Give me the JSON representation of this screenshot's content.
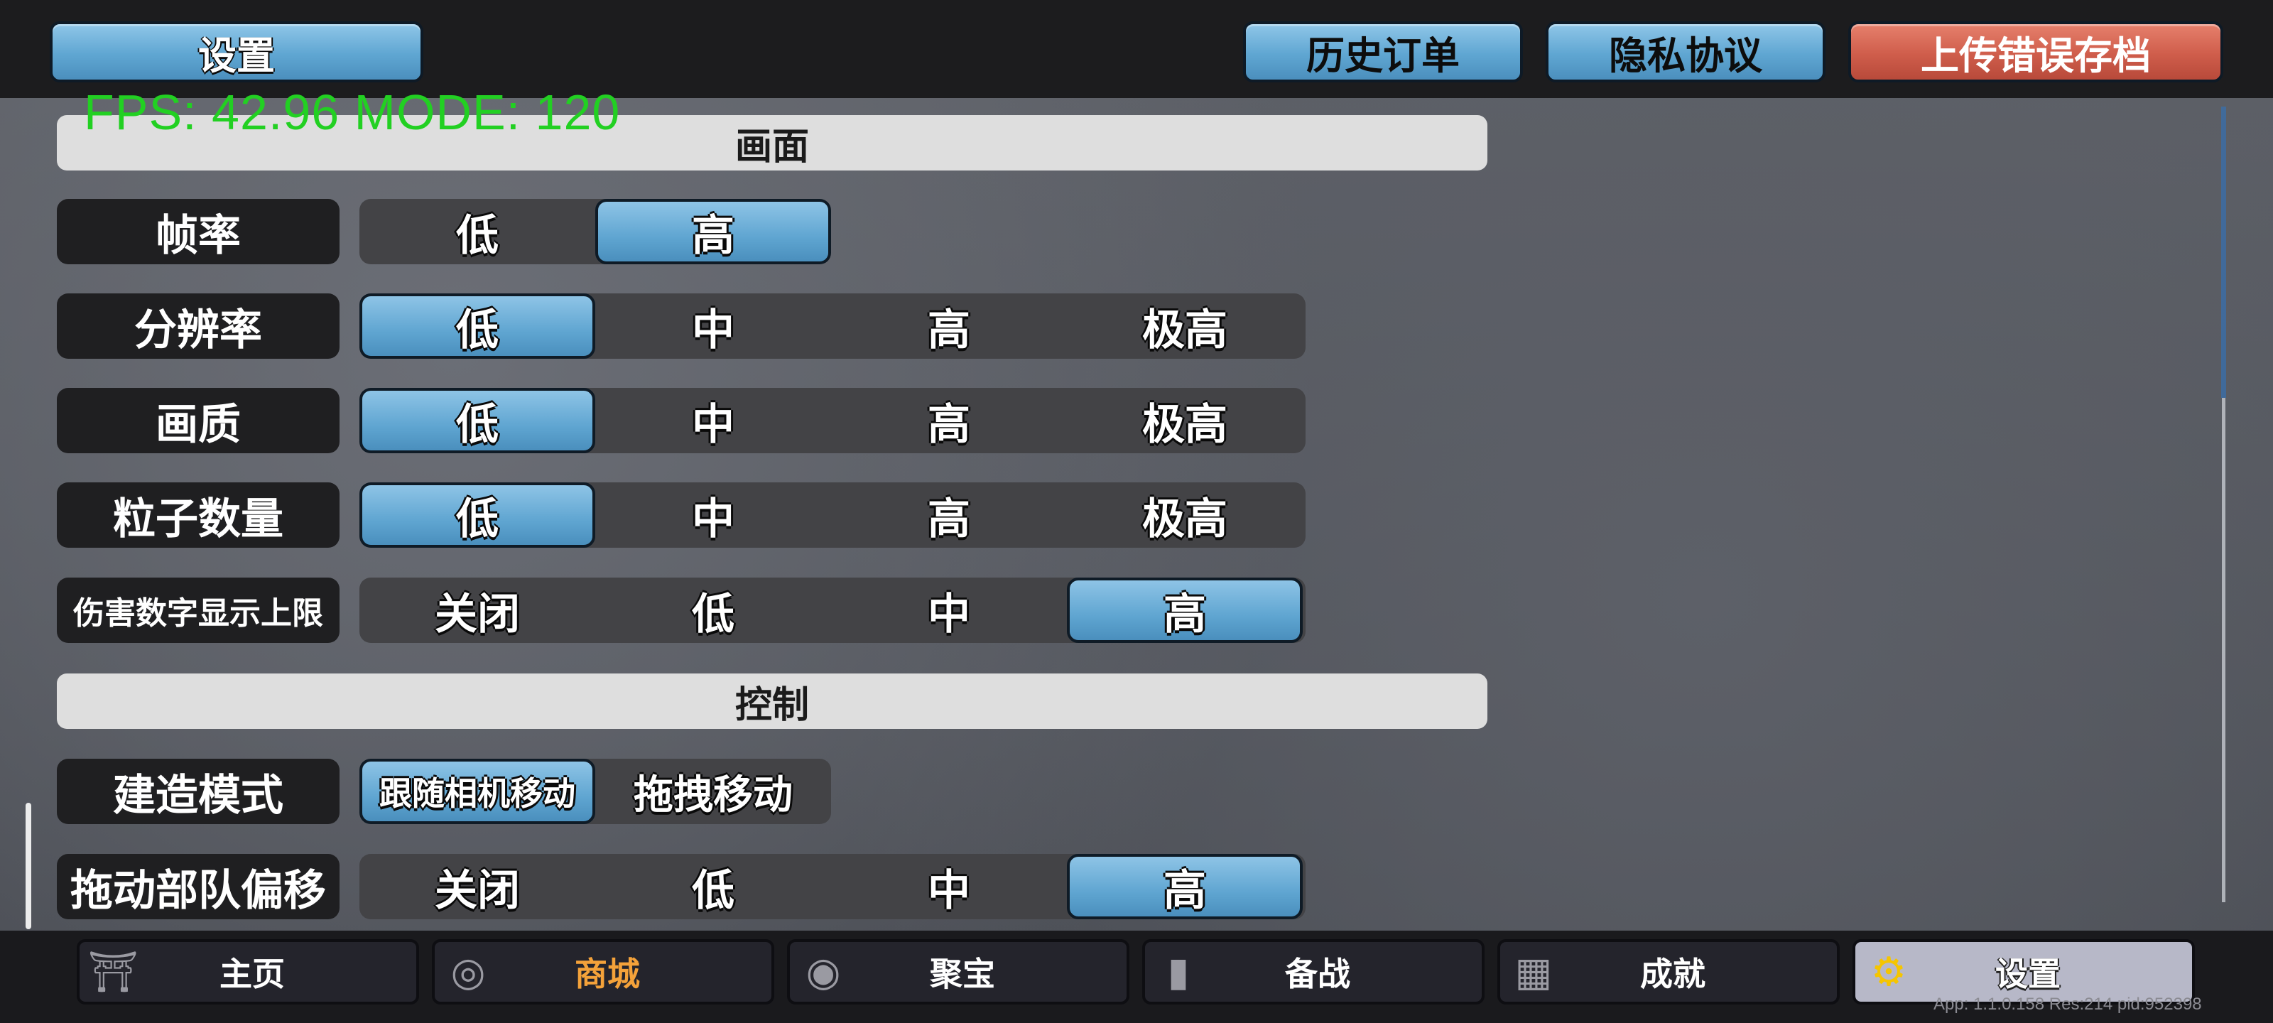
{
  "top": {
    "settings_title": "设置",
    "history_orders": "历史订单",
    "privacy": "隐私协议",
    "upload_error": "上传错误存档"
  },
  "fps_overlay": "FPS: 42.96  MODE: 120",
  "sections": {
    "display": "画面",
    "control": "控制"
  },
  "rows": {
    "framerate": {
      "label": "帧率",
      "options": [
        "低",
        "高"
      ],
      "selected": "高"
    },
    "resolution": {
      "label": "分辨率",
      "options": [
        "低",
        "中",
        "高",
        "极高"
      ],
      "selected": "低"
    },
    "quality": {
      "label": "画质",
      "options": [
        "低",
        "中",
        "高",
        "极高"
      ],
      "selected": "低"
    },
    "particles": {
      "label": "粒子数量",
      "options": [
        "低",
        "中",
        "高",
        "极高"
      ],
      "selected": "低"
    },
    "damage_numbers": {
      "label": "伤害数字显示上限",
      "options": [
        "关闭",
        "低",
        "中",
        "高"
      ],
      "selected": "高"
    },
    "build_mode": {
      "label": "建造模式",
      "options": [
        "跟随相机移动",
        "拖拽移动"
      ],
      "selected": "跟随相机移动"
    },
    "drag_offset": {
      "label": "拖动部队偏移",
      "options": [
        "关闭",
        "低",
        "中",
        "高"
      ],
      "selected": "高"
    }
  },
  "nav": [
    {
      "label": "主页",
      "icon": "home-icon"
    },
    {
      "label": "商城",
      "icon": "coins-icon"
    },
    {
      "label": "聚宝",
      "icon": "treasure-icon"
    },
    {
      "label": "备战",
      "icon": "cards-icon"
    },
    {
      "label": "成就",
      "icon": "achievements-icon"
    },
    {
      "label": "设置",
      "icon": "gear-icon"
    }
  ],
  "version": "App: 1.1.0.158 Res:214 pid:952398",
  "colors": {
    "accent_blue": "#5fa5d1",
    "danger_red": "#cf5d4b",
    "fps_green": "#22d022",
    "shop_orange": "#f4a23a"
  }
}
